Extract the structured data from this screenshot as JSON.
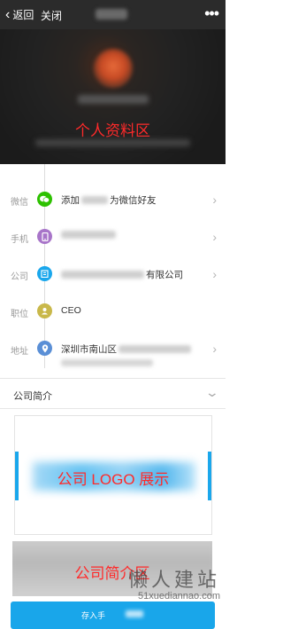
{
  "nav": {
    "back_label": "返回",
    "close_label": "关闭",
    "more_label": "•••"
  },
  "hero": {
    "caption": "个人资料区"
  },
  "rows": [
    {
      "label": "微信",
      "icon": "wechat-icon",
      "icon_color": "#2dc100",
      "value_prefix": "添加",
      "value_suffix": "为微信好友",
      "arrow": true
    },
    {
      "label": "手机",
      "icon": "phone-icon",
      "icon_color": "#a875c9",
      "value_prefix": "",
      "value_suffix": "",
      "arrow": true
    },
    {
      "label": "公司",
      "icon": "company-icon",
      "icon_color": "#1aa7ec",
      "value_prefix": "",
      "value_suffix": "有限公司",
      "arrow": true
    },
    {
      "label": "职位",
      "icon": "person-icon",
      "icon_color": "#c9b84a",
      "value_prefix": "CEO",
      "value_suffix": "",
      "arrow": false
    },
    {
      "label": "地址",
      "icon": "location-icon",
      "icon_color": "#5a8fd6",
      "value_prefix": "深圳市南山区",
      "value_suffix": "",
      "arrow": true
    }
  ],
  "company_intro": {
    "title": "公司简介",
    "logo_caption": "公司 LOGO 展示",
    "intro_caption": "公司简介区"
  },
  "save_button": {
    "label": "存入手"
  },
  "watermark": {
    "title": "懒人建站",
    "url": "51xuediannao.com"
  },
  "colors": {
    "accent": "#19a6ea",
    "annotation": "#ff2a2a",
    "navbar": "#2b2b2b"
  }
}
